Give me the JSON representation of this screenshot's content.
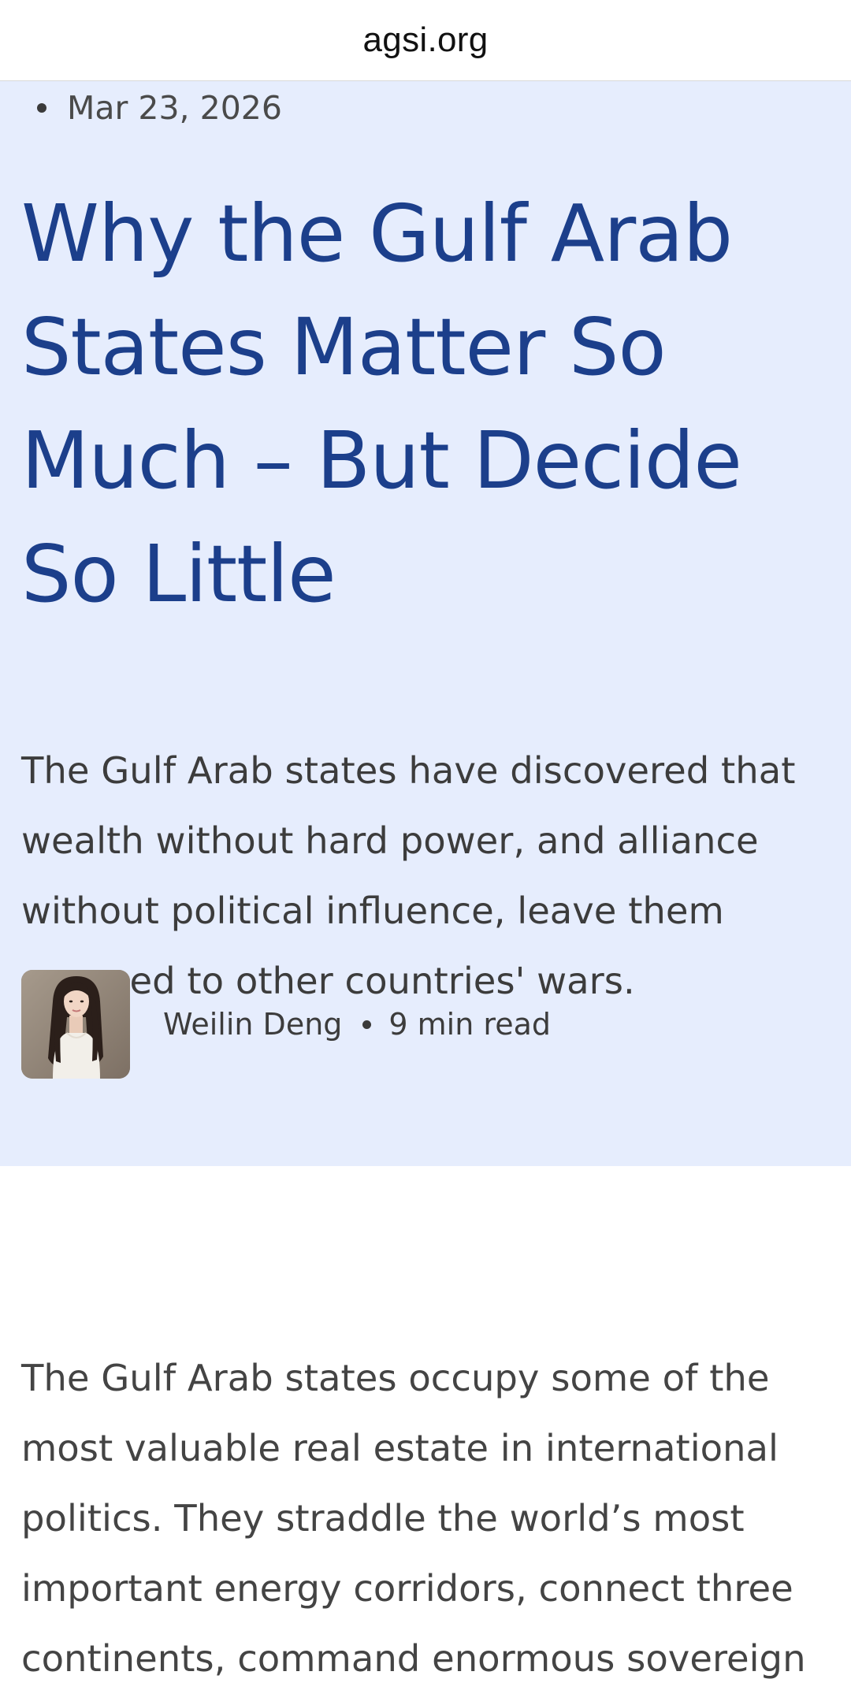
{
  "browser": {
    "url": "agsi.org"
  },
  "article": {
    "date": "Mar 23, 2026",
    "headline": "Why the Gulf Arab States Matter So Much – But Decide So Little",
    "dek": "The Gulf Arab states have discovered that wealth without hard power, and alliance without political influence, leave them exposed to other countries' wars.",
    "author": "Weilin Deng",
    "read_time": "9 min read",
    "body_intro": "The Gulf Arab states occupy some of the most valuable real estate in international politics. They straddle the world’s most important energy corridors, connect three continents, command enormous sovereign"
  },
  "colors": {
    "hero_background": "#e6edfd",
    "headline": "#1c3f8b",
    "body_text": "#444444"
  }
}
